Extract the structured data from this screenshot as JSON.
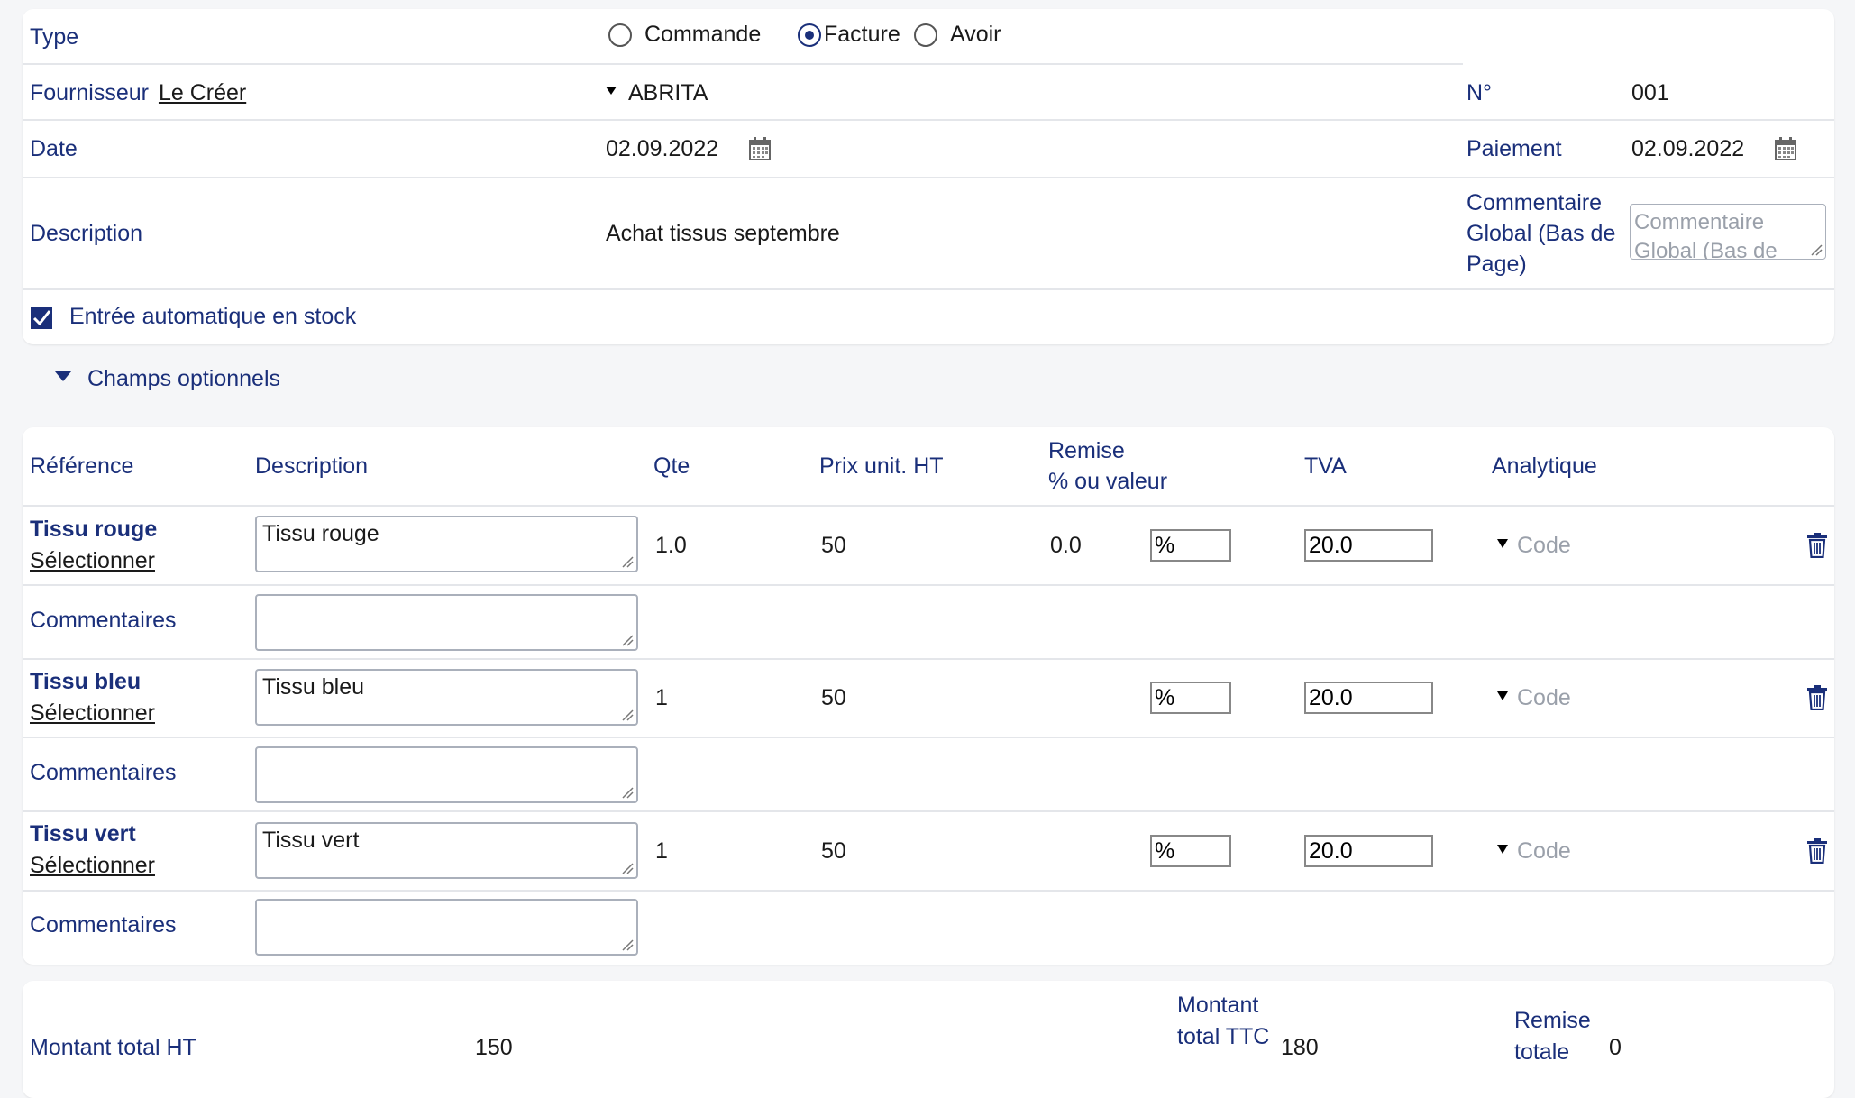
{
  "header": {
    "type_label": "Type",
    "type_options": [
      {
        "label": "Commande",
        "checked": false
      },
      {
        "label": "Facture",
        "checked": true
      },
      {
        "label": "Avoir",
        "checked": false
      }
    ],
    "supplier_label": "Fournisseur",
    "supplier_create_link": "Le Créer",
    "supplier_value": "ABRITA",
    "number_label": "N°",
    "number_value": "001",
    "date_label": "Date",
    "date_value": "02.09.2022",
    "payment_label": "Paiement",
    "payment_value": "02.09.2022",
    "description_label": "Description",
    "description_value": "Achat tissus septembre",
    "global_comment_label": "Commentaire Global (Bas de Page)",
    "global_comment_placeholder": "Commentaire Global (Bas de Page)",
    "auto_stock_label": "Entrée automatique en stock",
    "auto_stock_checked": true
  },
  "optional_fields_label": "Champs optionnels",
  "lines": {
    "columns": {
      "reference": "Référence",
      "description": "Description",
      "qty": "Qte",
      "unit_price": "Prix unit. HT",
      "discount_line1": "Remise",
      "discount_line2": "% ou valeur",
      "vat": "TVA",
      "analytic": "Analytique"
    },
    "select_label": "Sélectionner",
    "comments_label": "Commentaires",
    "code_placeholder": "Code",
    "items": [
      {
        "reference": "Tissu rouge",
        "description": "Tissu rouge",
        "qty": "1.0",
        "unit_price": "50",
        "discount": "0.0",
        "discount_type": "%",
        "vat": "20.0"
      },
      {
        "reference": "Tissu bleu",
        "description": "Tissu bleu",
        "qty": "1",
        "unit_price": "50",
        "discount": "",
        "discount_type": "%",
        "vat": "20.0"
      },
      {
        "reference": "Tissu vert",
        "description": "Tissu vert",
        "qty": "1",
        "unit_price": "50",
        "discount": "",
        "discount_type": "%",
        "vat": "20.0"
      }
    ]
  },
  "totals": {
    "total_ht_label": "Montant total HT",
    "total_ht_value": "150",
    "total_ttc_label": "Montant total TTC",
    "total_ttc_value": "180",
    "total_discount_label": "Remise totale",
    "total_discount_value": "0"
  },
  "colors": {
    "label_blue": "#1a2f7a",
    "border": "#e4e6ea"
  }
}
